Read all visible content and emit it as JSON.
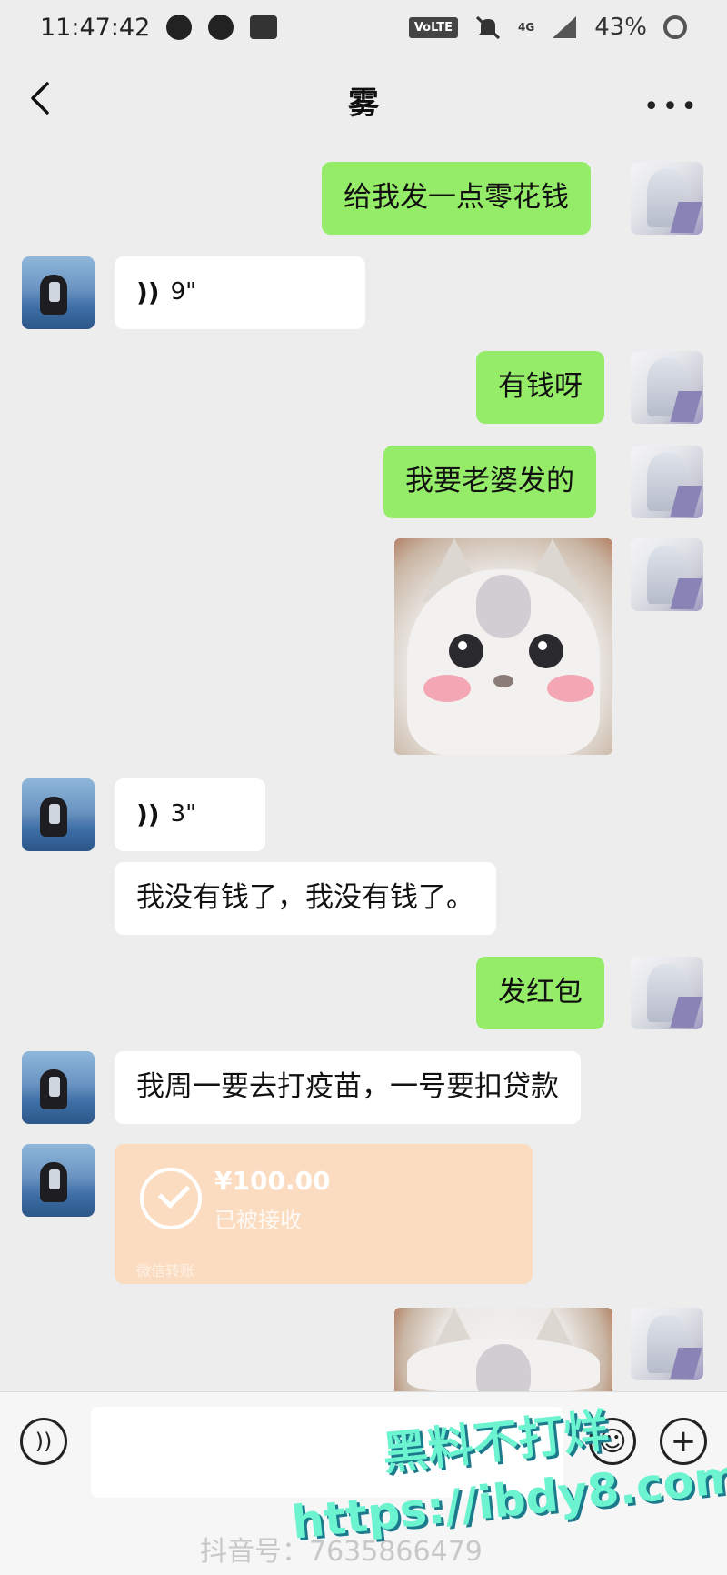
{
  "status_bar": {
    "time": "11:47:42",
    "network_badge": "VoLTE",
    "network_type": "4G",
    "battery": "43%",
    "icons": [
      "tiktok-icon",
      "shield-icon",
      "notification-icon",
      "mute-icon",
      "signal-icon",
      "battery-ring-icon"
    ]
  },
  "header": {
    "title": "雾",
    "back_icon": "chevron-left-icon",
    "more_label": "•••"
  },
  "messages": [
    {
      "side": "me",
      "type": "text",
      "text": "给我发一点零花钱"
    },
    {
      "side": "other",
      "type": "voice",
      "duration": "9\""
    },
    {
      "side": "me",
      "type": "text",
      "text": "有钱呀"
    },
    {
      "side": "me",
      "type": "text",
      "text": "我要老婆发的"
    },
    {
      "side": "me",
      "type": "sticker",
      "sticker": "cat-sticker"
    },
    {
      "side": "other",
      "type": "voice",
      "duration": "3\""
    },
    {
      "side": "other",
      "type": "text",
      "text": "我没有钱了，我没有钱了。"
    },
    {
      "side": "me",
      "type": "text",
      "text": "发红包"
    },
    {
      "side": "other",
      "type": "text",
      "text": "我周一要去打疫苗，一号要扣贷款"
    },
    {
      "side": "other",
      "type": "red_packet",
      "amount": "¥100.00",
      "status": "已被接收",
      "footer": "微信转账"
    },
    {
      "side": "me",
      "type": "sticker",
      "sticker": "cat-sticker"
    }
  ],
  "voice_icon": "))",
  "input_bar": {
    "voice_button_icon": "voice-mode-icon",
    "voice_glyph": "))",
    "emoji_button_icon": "emoji-icon",
    "emoji_glyph": "☺",
    "plus_button_icon": "plus-icon",
    "plus_glyph": "+",
    "bottom_watermark": "抖音号：7635866479"
  },
  "overlay": {
    "title": "黑料不打烊",
    "url": "https://ibdy8.com"
  },
  "colors": {
    "background": "#ededed",
    "my_bubble": "#95ec69",
    "other_bubble": "#ffffff",
    "red_packet": "#fbdcc0",
    "watermark": "#6cf3cf"
  }
}
